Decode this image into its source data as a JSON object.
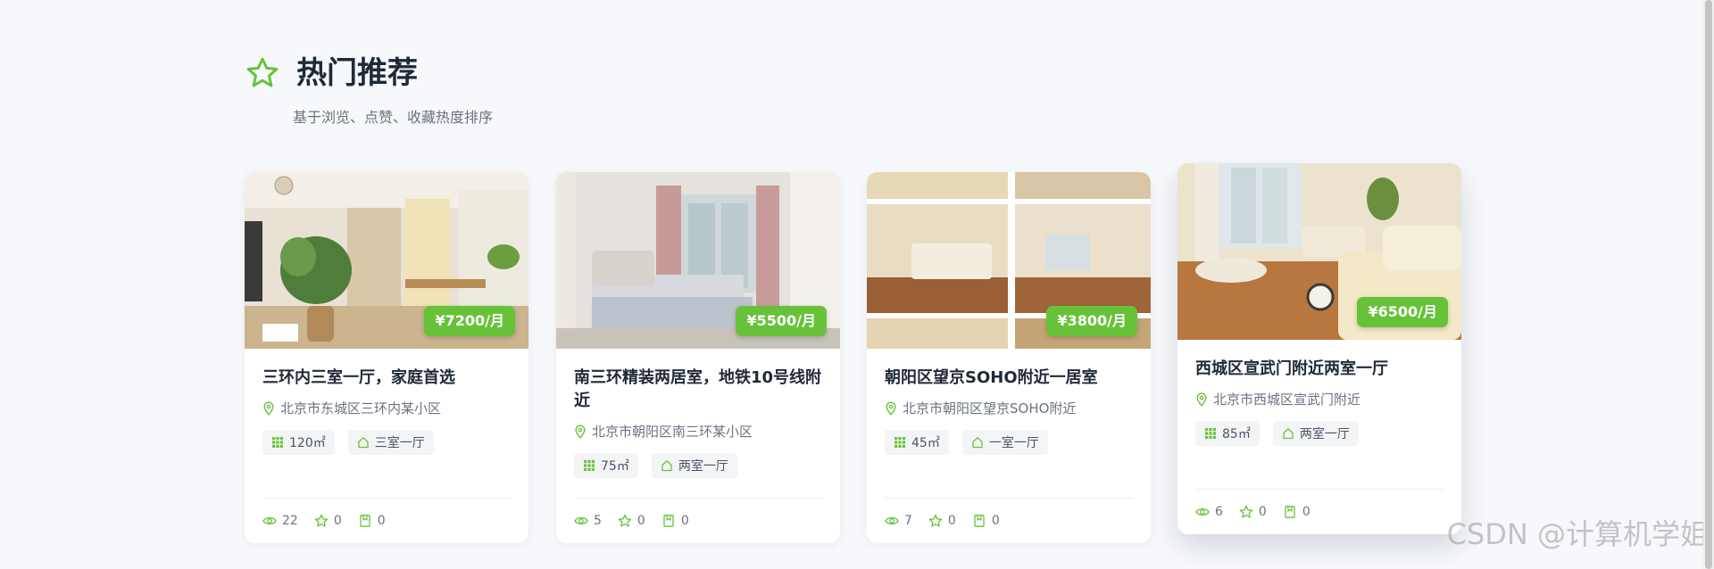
{
  "section": {
    "title": "热门推荐",
    "subtitle": "基于浏览、点赞、收藏热度排序",
    "icon": "star-outline-icon",
    "accent": "#67c23a"
  },
  "cards": [
    {
      "title": "三环内三室一厅，家庭首选",
      "price": "¥7200/月",
      "address": "北京市东城区三环内某小区",
      "area": "120㎡",
      "layout": "三室一厅",
      "views": "22",
      "likes": "0",
      "favorites": "0"
    },
    {
      "title": "南三环精装两居室，地铁10号线附近",
      "price": "¥5500/月",
      "address": "北京市朝阳区南三环某小区",
      "area": "75㎡",
      "layout": "两室一厅",
      "views": "5",
      "likes": "0",
      "favorites": "0"
    },
    {
      "title": "朝阳区望京SOHO附近一居室",
      "price": "¥3800/月",
      "address": "北京市朝阳区望京SOHO附近",
      "area": "45㎡",
      "layout": "一室一厅",
      "views": "7",
      "likes": "0",
      "favorites": "0"
    },
    {
      "title": "西城区宣武门附近两室一厅",
      "price": "¥6500/月",
      "address": "北京市西城区宣武门附近",
      "area": "85㎡",
      "layout": "两室一厅",
      "views": "6",
      "likes": "0",
      "favorites": "0"
    }
  ],
  "watermark": "CSDN @计算机学姐"
}
